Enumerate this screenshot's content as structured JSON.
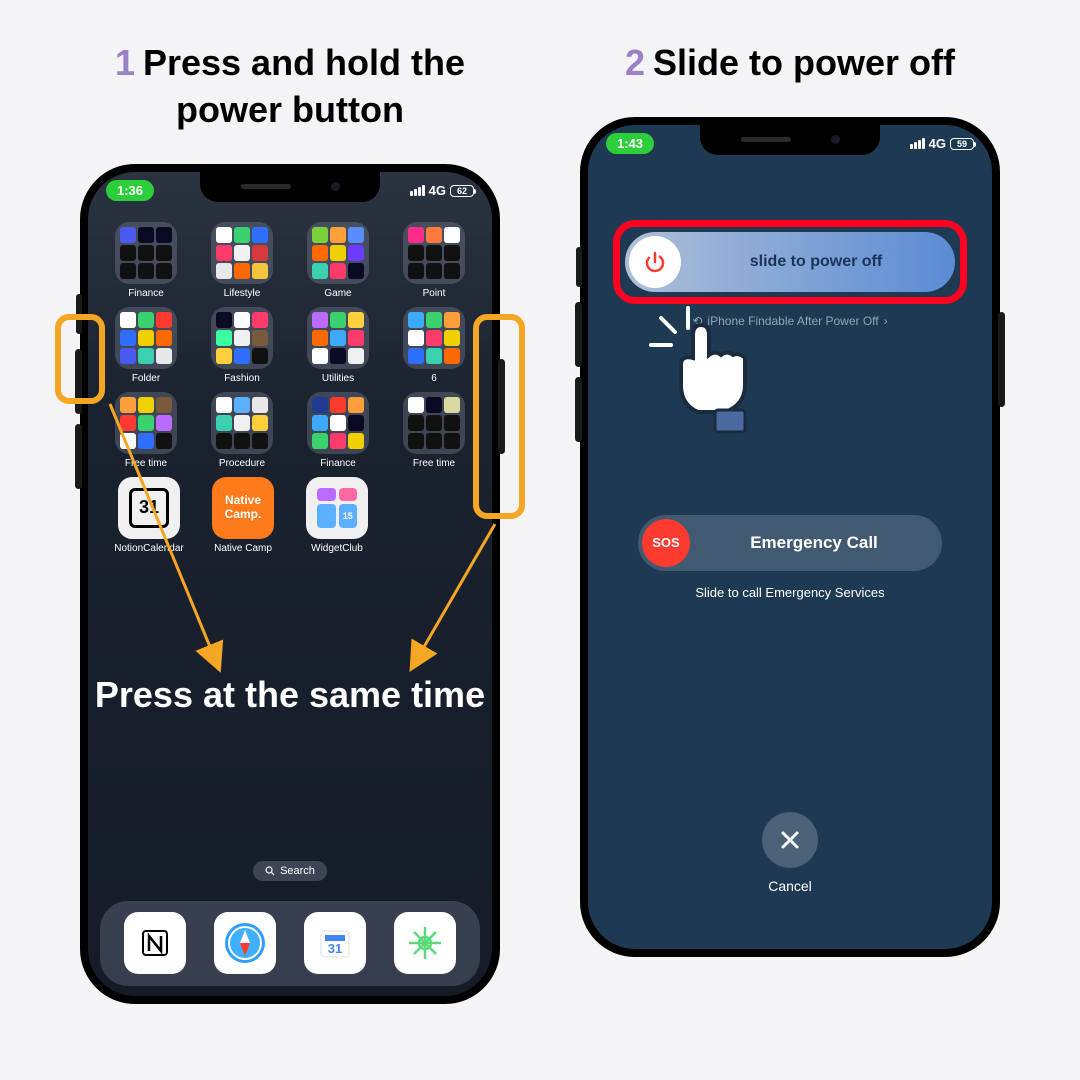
{
  "step1": {
    "num": "1",
    "title": "Press and hold the power button",
    "overlay": "Press at the same time",
    "time": "1:36",
    "net": "4G",
    "batt": "62",
    "search": "Search",
    "rows": [
      [
        {
          "label": "Finance",
          "c": [
            "#4a5aef",
            "#0a0a25",
            "#0a0a25",
            "#111",
            "#111",
            "#111",
            "#111",
            "#111",
            "#111"
          ]
        },
        {
          "label": "Lifestyle",
          "c": [
            "#fff",
            "#3bd16f",
            "#2f6fff",
            "#ff3b6b",
            "#f0f0f0",
            "#d63a3a",
            "#e8e8e8",
            "#ff6a00",
            "#f5c542"
          ]
        },
        {
          "label": "Game",
          "c": [
            "#7bd13b",
            "#ff9f3b",
            "#5a8bff",
            "#ff6a00",
            "#f0d000",
            "#6b3bff",
            "#3bd1b0",
            "#ff3b6b",
            "#0a0a25"
          ]
        },
        {
          "label": "Point",
          "c": [
            "#ff2d87",
            "#ff7a3b",
            "#fff",
            "#111",
            "#111",
            "#111",
            "#111",
            "#111",
            "#111"
          ]
        }
      ],
      [
        {
          "label": "Folder",
          "c": [
            "#fff",
            "#3bd16f",
            "#ff3b30",
            "#2f6fff",
            "#f0d000",
            "#ff6a00",
            "#4a5aef",
            "#3bd1b0",
            "#e8e8e8"
          ]
        },
        {
          "label": "Fashion",
          "c": [
            "#0a0a25",
            "#fff",
            "#ff3b6b",
            "#3bff9f",
            "#f0f0f0",
            "#7a5a3a",
            "#ffcf3b",
            "#2f6fff",
            "#111"
          ]
        },
        {
          "label": "Utilities",
          "c": [
            "#bb6bff",
            "#3bd16f",
            "#ffcf3b",
            "#ff6a00",
            "#3baaff",
            "#ff3b6b",
            "#fff",
            "#0a0a25",
            "#f0f0f0"
          ]
        },
        {
          "label": "6",
          "c": [
            "#3baaff",
            "#3bd16f",
            "#ff9f3b",
            "#fff",
            "#ff3b6b",
            "#f0d000",
            "#2f6fff",
            "#3bd1b0",
            "#ff6a00"
          ]
        }
      ],
      [
        {
          "label": "Free time",
          "c": [
            "#ff9f3b",
            "#f0d000",
            "#7a5a3a",
            "#ff3b30",
            "#3bd16f",
            "#bb6bff",
            "#fff",
            "#2f6fff",
            "#111"
          ]
        },
        {
          "label": "Procedure",
          "c": [
            "#fff",
            "#5ab0ff",
            "#e8e8e8",
            "#3bd1b0",
            "#f0f0f0",
            "#ffcf3b",
            "#111",
            "#111",
            "#111"
          ]
        },
        {
          "label": "Finance",
          "c": [
            "#213a8f",
            "#ff3b30",
            "#ff9f3b",
            "#3baaff",
            "#fff",
            "#0a0a25",
            "#3bd16f",
            "#ff3b6b",
            "#f0d000"
          ]
        },
        {
          "label": "Free time",
          "c": [
            "#fff",
            "#0a0a25",
            "#d8d8a0",
            "#111",
            "#111",
            "#111",
            "#111",
            "#111",
            "#111"
          ]
        }
      ]
    ],
    "apps": [
      {
        "label": "NotionCalendar",
        "text": "31",
        "bg": "#f0f0f0",
        "fg": "#000"
      },
      {
        "label": "Native Camp",
        "text": "Native Camp.",
        "bg": "#ff7a1a",
        "fg": "#fff"
      },
      {
        "label": "WidgetClub",
        "text": "",
        "bg": "#f0f0f0",
        "fg": "#000"
      }
    ]
  },
  "step2": {
    "num": "2",
    "title": "Slide to power off",
    "time": "1:43",
    "net": "4G",
    "batt": "59",
    "slider": "slide to power off",
    "findable": "iPhone Findable After Power Off",
    "sos": "SOS",
    "emergency": "Emergency Call",
    "emergency_sub": "Slide to call Emergency Services",
    "cancel": "Cancel"
  }
}
